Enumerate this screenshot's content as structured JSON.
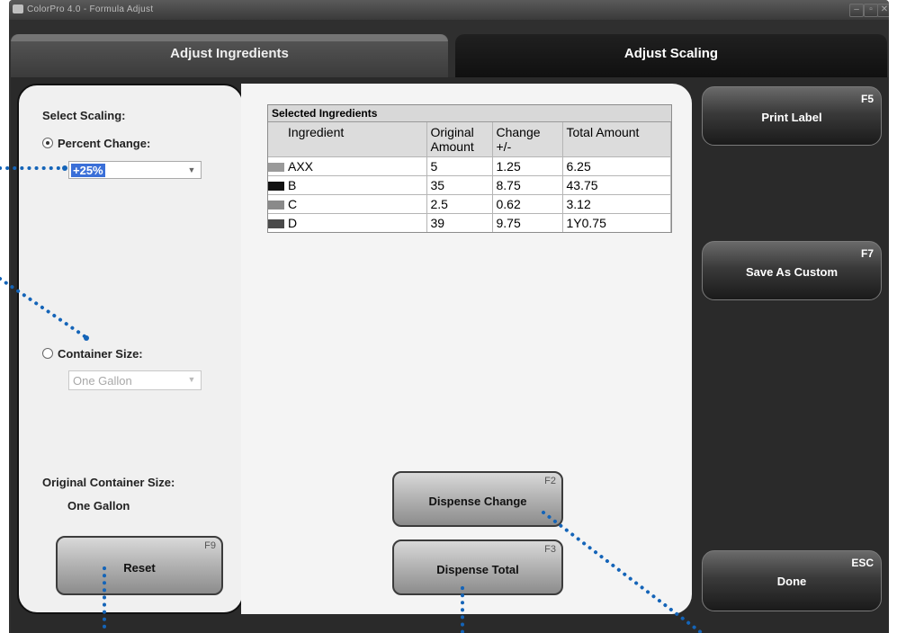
{
  "window": {
    "title": "ColorPro 4.0 - Formula Adjust"
  },
  "tabs": [
    {
      "label": "Adjust Ingredients"
    },
    {
      "label": "Adjust Scaling"
    }
  ],
  "left_panel": {
    "select_scaling_label": "Select Scaling:",
    "percent_change_label": "Percent Change:",
    "percent_change_value": "+25%",
    "container_size_label": "Container Size:",
    "container_size_value": "One Gallon",
    "original_container_label": "Original Container Size:",
    "original_container_value": "One Gallon",
    "reset": {
      "label": "Reset",
      "key": "F9"
    }
  },
  "grid": {
    "title": "Selected Ingredients",
    "columns": [
      "Ingredient",
      "Original Amount",
      "Change +/-",
      "Total Amount"
    ],
    "rows": [
      {
        "ingredient": "AXX",
        "original": "5",
        "change": "1.25",
        "total": "6.25",
        "color": "#9a9a9a"
      },
      {
        "ingredient": "B",
        "original": "35",
        "change": "8.75",
        "total": "43.75",
        "color": "#111111"
      },
      {
        "ingredient": "C",
        "original": "2.5",
        "change": "0.62",
        "total": "3.12",
        "color": "#8a8a8a"
      },
      {
        "ingredient": "D",
        "original": "39",
        "change": "9.75",
        "total": "1Y0.75",
        "color": "#4a4a4a"
      }
    ]
  },
  "buttons": {
    "dispense_change": {
      "label": "Dispense Change",
      "key": "F2"
    },
    "dispense_total": {
      "label": "Dispense Total",
      "key": "F3"
    },
    "print_label": {
      "label": "Print Label",
      "key": "F5"
    },
    "save_custom": {
      "label": "Save As Custom",
      "key": "F7"
    },
    "done": {
      "label": "Done",
      "key": "ESC"
    }
  },
  "accent_color": "#1464b8",
  "selection_color": "#3a6fd8"
}
